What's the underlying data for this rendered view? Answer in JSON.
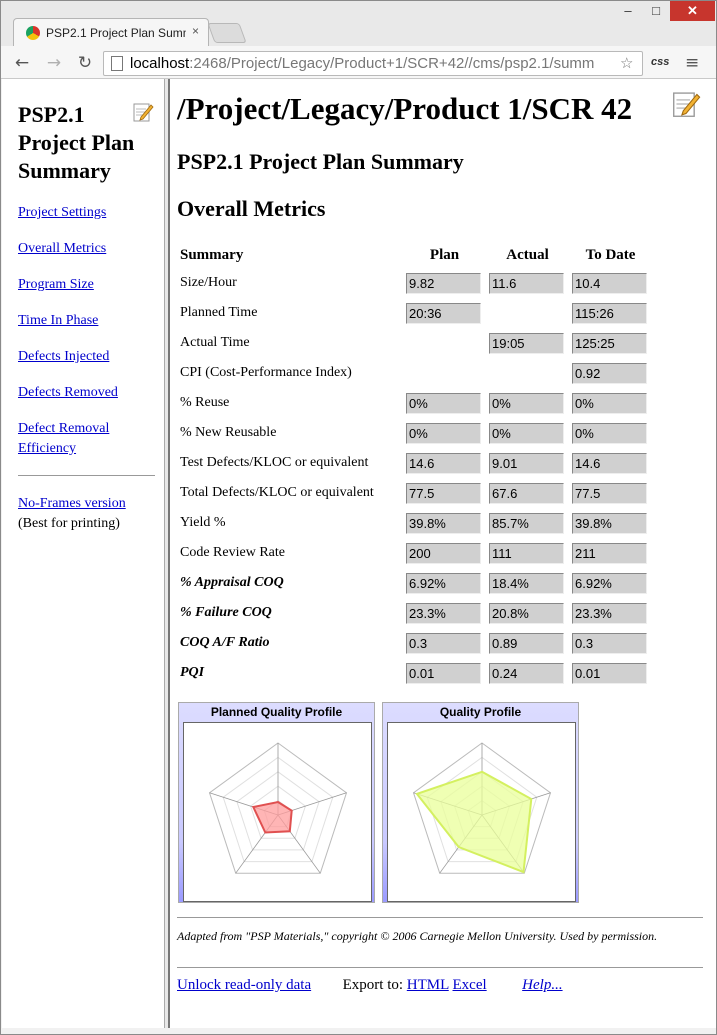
{
  "browser": {
    "tab_title": "PSP2.1 Project Plan Summ",
    "tab_close": "×",
    "url_host": "localhost",
    "url_rest": ":2468/Project/Legacy/Product+1/SCR+42//cms/psp2.1/summ",
    "minimize": "–",
    "maximize": "□",
    "close": "✕",
    "back": "←",
    "forward": "→",
    "reload": "↻",
    "star": "☆",
    "extension": "css",
    "menu": "≡"
  },
  "sidebar": {
    "title": "PSP2.1 Project Plan Summary",
    "links": [
      "Project Settings",
      "Overall Metrics",
      "Program Size",
      "Time In Phase",
      "Defects Injected",
      "Defects Removed",
      "Defect Removal Efficiency"
    ],
    "noframes_link": "No-Frames version",
    "noframes_note": "(Best for printing)"
  },
  "main": {
    "path_title": "/Project/Legacy/Product 1/SCR 42",
    "page_title": "PSP2.1 Project Plan Summary",
    "section_title": "Overall Metrics",
    "table": {
      "headers": [
        "Summary",
        "Plan",
        "Actual",
        "To Date"
      ],
      "rows": [
        {
          "label": "Size/Hour",
          "italic": false,
          "values": [
            "9.82",
            "11.6",
            "10.4"
          ]
        },
        {
          "label": "Planned Time",
          "italic": false,
          "values": [
            "20:36",
            "",
            "115:26"
          ]
        },
        {
          "label": "Actual Time",
          "italic": false,
          "values": [
            "",
            "19:05",
            "125:25"
          ]
        },
        {
          "label": "CPI (Cost-Performance Index)",
          "italic": false,
          "values": [
            "",
            "",
            "0.92"
          ]
        },
        {
          "label": "% Reuse",
          "italic": false,
          "values": [
            "0%",
            "0%",
            "0%"
          ]
        },
        {
          "label": "% New Reusable",
          "italic": false,
          "values": [
            "0%",
            "0%",
            "0%"
          ]
        },
        {
          "label": "Test Defects/KLOC or equivalent",
          "italic": false,
          "values": [
            "14.6",
            "9.01",
            "14.6"
          ]
        },
        {
          "label": "Total Defects/KLOC or equivalent",
          "italic": false,
          "values": [
            "77.5",
            "67.6",
            "77.5"
          ]
        },
        {
          "label": "Yield %",
          "italic": false,
          "values": [
            "39.8%",
            "85.7%",
            "39.8%"
          ]
        },
        {
          "label": "Code Review Rate",
          "italic": false,
          "values": [
            "200",
            "111",
            "211"
          ]
        },
        {
          "label": "% Appraisal COQ",
          "italic": true,
          "values": [
            "6.92%",
            "18.4%",
            "6.92%"
          ]
        },
        {
          "label": "% Failure COQ",
          "italic": true,
          "values": [
            "23.3%",
            "20.8%",
            "23.3%"
          ]
        },
        {
          "label": "COQ A/F Ratio",
          "italic": true,
          "values": [
            "0.3",
            "0.89",
            "0.3"
          ]
        },
        {
          "label": "PQI",
          "italic": true,
          "values": [
            "0.01",
            "0.24",
            "0.01"
          ]
        }
      ]
    },
    "charts": [
      {
        "title": "Planned Quality Profile",
        "values": [
          0.18,
          0.2,
          0.28,
          0.3,
          0.36
        ],
        "fill": "#ff9c9c",
        "stroke": "#e05050"
      },
      {
        "title": "Quality Profile",
        "values": [
          0.6,
          0.72,
          0.98,
          0.55,
          0.95
        ],
        "fill": "#eaff9a",
        "stroke": "#d4f060"
      }
    ],
    "footnote": "Adapted from \"PSP Materials,\" copyright © 2006 Carnegie Mellon University. Used by permission.",
    "unlock_link": "Unlock read-only data",
    "export_label": "Export to:",
    "export_html": "HTML",
    "export_excel": "Excel",
    "help_link": "Help..."
  },
  "colors": {
    "link": "#0000cc",
    "readonly_field": "#d0d0d0",
    "chart_header": "#c9c9ff"
  }
}
